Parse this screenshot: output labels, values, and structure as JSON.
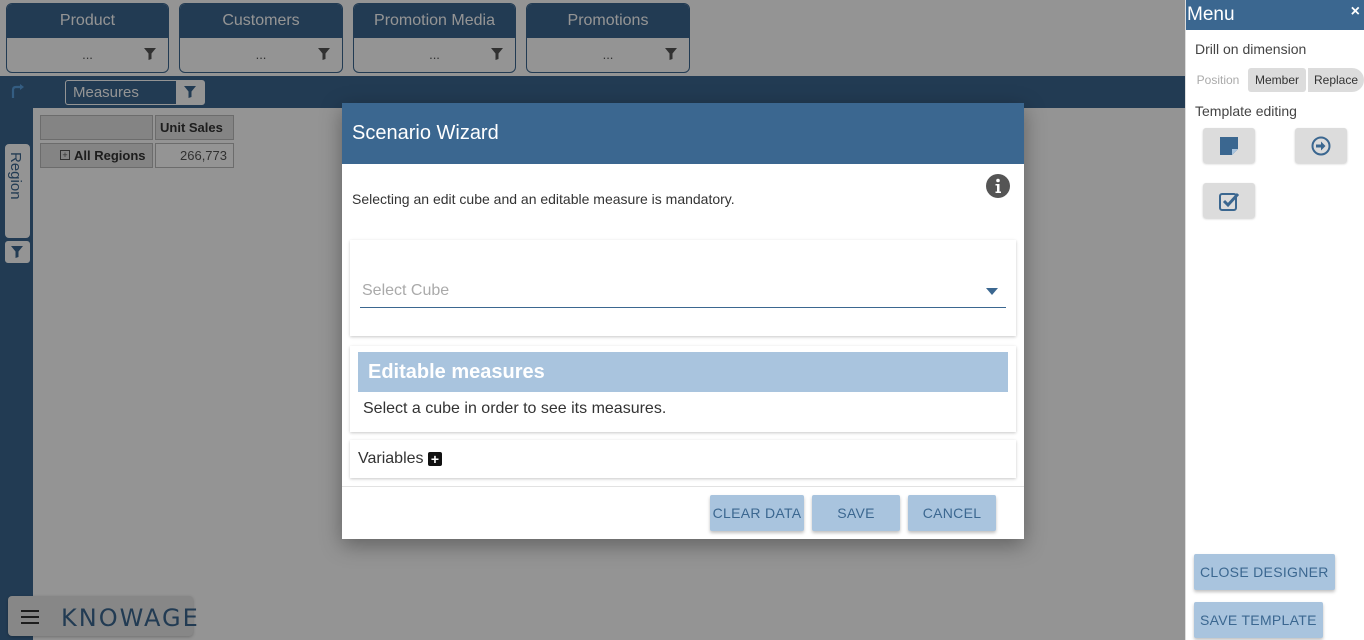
{
  "dimensions": [
    {
      "label": "Product",
      "value": "..."
    },
    {
      "label": "Customers",
      "value": "..."
    },
    {
      "label": "Promotion Media",
      "value": "..."
    },
    {
      "label": "Promotions",
      "value": "..."
    }
  ],
  "measures_bar": {
    "label": "Measures"
  },
  "rows_axis": {
    "label": "Region"
  },
  "table": {
    "column_header": "Unit Sales",
    "rows": [
      {
        "label": "All Regions",
        "value": "266,773"
      }
    ]
  },
  "logo": {
    "text": "KNOWAGE"
  },
  "menu": {
    "title": "Menu",
    "close": "×",
    "drill_title": "Drill on dimension",
    "drill_options": [
      "Position",
      "Member",
      "Replace"
    ],
    "template_title": "Template editing",
    "close_designer": "CLOSE DESIGNER",
    "save_template": "SAVE TEMPLATE"
  },
  "modal": {
    "title": "Scenario Wizard",
    "intro": "Selecting an edit cube and an editable measure is mandatory.",
    "select_cube_placeholder": "Select Cube",
    "editable_measures_title": "Editable measures",
    "editable_measures_text": "Select a cube in order to see its measures.",
    "variables_label": "Variables",
    "buttons": {
      "clear": "CLEAR DATA",
      "save": "SAVE",
      "cancel": "CANCEL"
    }
  },
  "colors": {
    "primary": "#3b6790",
    "accent_light": "#a9c4de",
    "overlay": "rgba(0,0,0,0.42)"
  }
}
